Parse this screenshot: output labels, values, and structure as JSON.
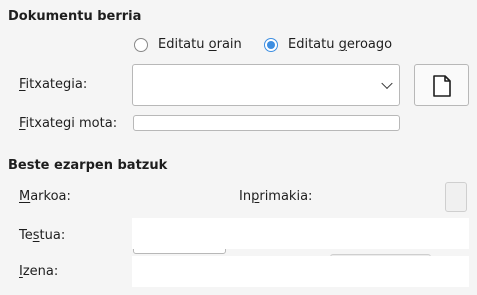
{
  "sections": {
    "new_document": {
      "title": "Dokumentu berria",
      "radio_edit_now": {
        "label": "Editatu orain",
        "checked": false
      },
      "radio_edit_later": {
        "label": "Editatu geroago",
        "checked": true
      },
      "file_label": "Fitxategia:",
      "file_value": "",
      "file_button_icon": "new-document-icon",
      "file_type_label": "Fitxategi mota:",
      "file_type_value": ""
    },
    "more_settings": {
      "title": "Beste ezarpen batzuk",
      "frame_label": "Markoa:",
      "frame_value": "",
      "print_label": "Inprimakia:",
      "print_value": "",
      "text_label": "Testua:",
      "text_value": "",
      "name_label": "Izena:",
      "name_value": ""
    }
  },
  "colors": {
    "accent": "#3d8ee1",
    "background": "#f5f5f5",
    "field_border": "#b8b8b8"
  }
}
